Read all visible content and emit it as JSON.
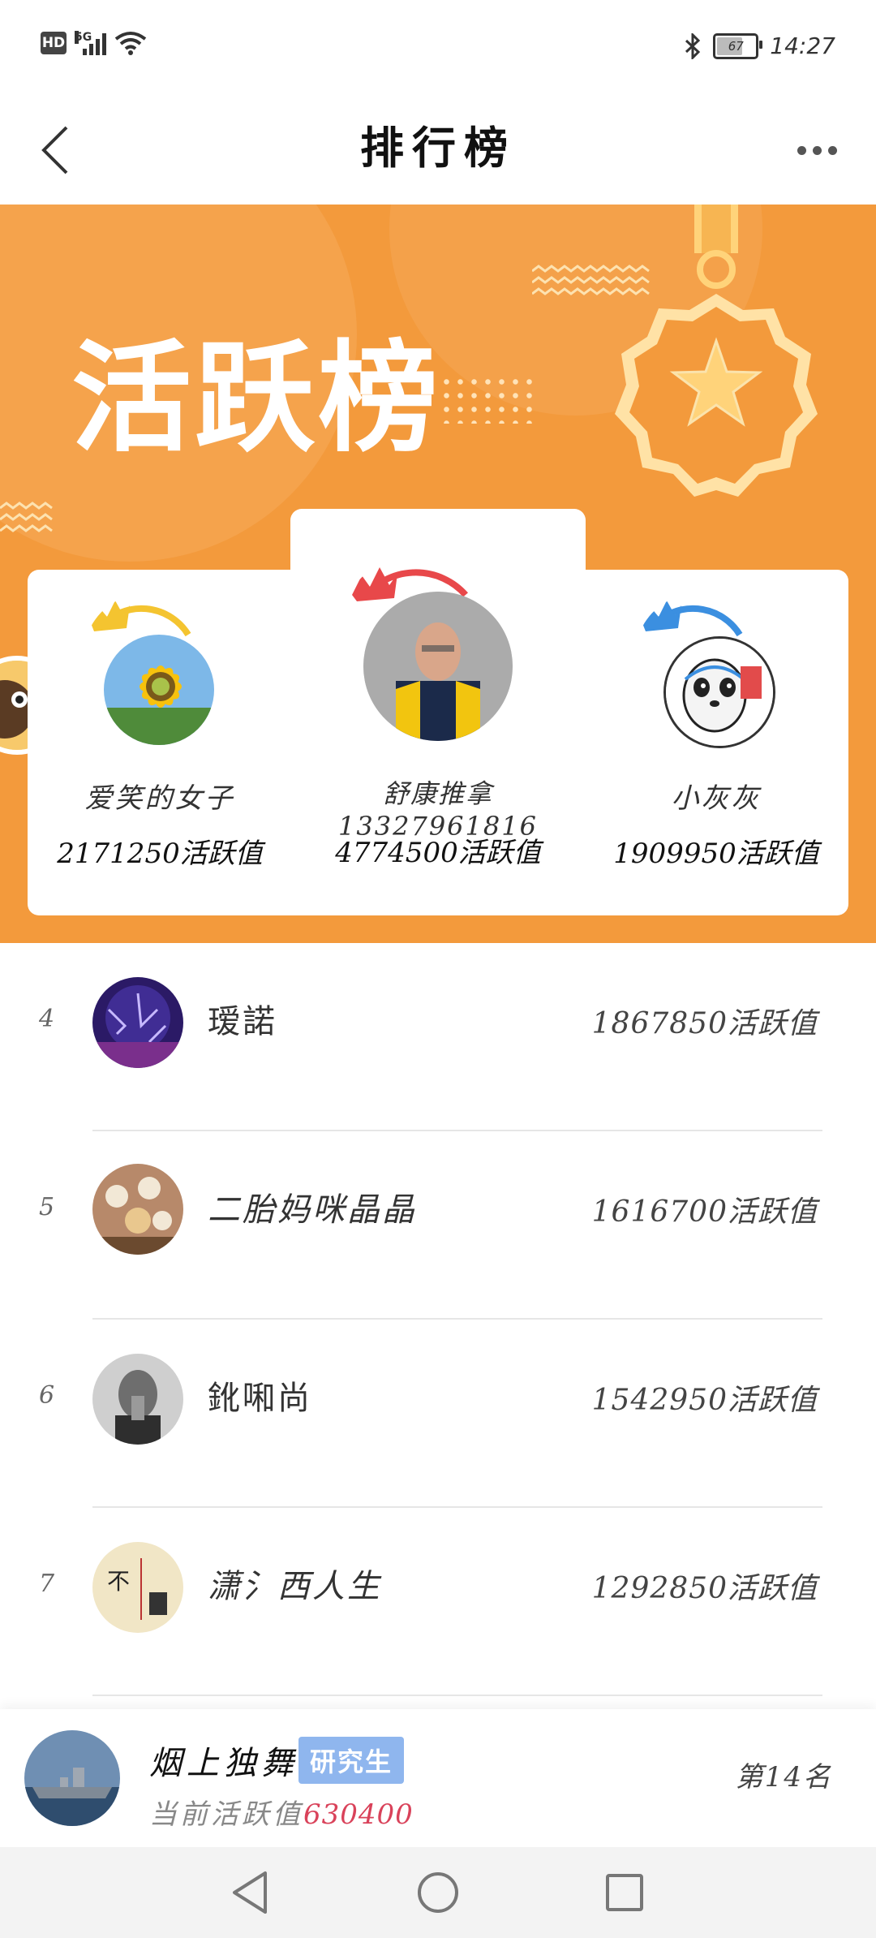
{
  "status_bar": {
    "hd": "HD",
    "network": "5G",
    "time": "14:27",
    "battery": "67"
  },
  "header": {
    "title": "排行榜"
  },
  "banner": {
    "title": "活跃榜"
  },
  "podium": [
    {
      "position": "second",
      "name": "爱笑的女子",
      "score": "2171250活跃值",
      "crown_color": "#f4c430"
    },
    {
      "position": "first",
      "name": "舒康推拿13327961816",
      "score": "4774500活跃值",
      "crown_color": "#e8484a"
    },
    {
      "position": "third",
      "name": "小灰灰",
      "score": "1909950活跃值",
      "crown_color": "#3b8fe0"
    }
  ],
  "ranking": [
    {
      "rank": "4",
      "name": "瑷諾",
      "score": "1867850活跃值"
    },
    {
      "rank": "5",
      "name": "二胎妈咪晶晶",
      "score": "1616700活跃值"
    },
    {
      "rank": "6",
      "name": "鈋啝尚",
      "score": "1542950活跃值"
    },
    {
      "rank": "7",
      "name": "潇氵西人生",
      "score": "1292850活跃值"
    }
  ],
  "me": {
    "name": "烟上独舞",
    "badge": "研究生",
    "label": "当前活跃值",
    "value": "630400",
    "rank": "第14名"
  },
  "colors": {
    "banner": "#f39a3c",
    "badge": "#8fb6ee",
    "value": "#d9425a"
  }
}
